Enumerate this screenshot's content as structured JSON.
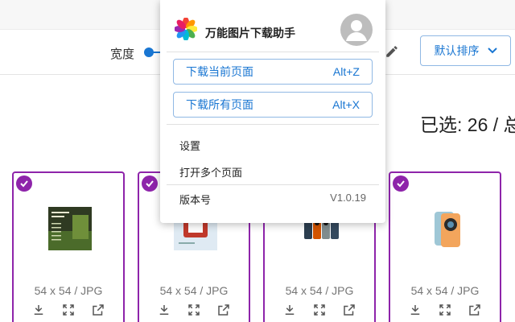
{
  "toolbar": {
    "width_label": "宽度",
    "width_value_fraction": 0.05,
    "sort_label": "默认排序"
  },
  "selection": {
    "text": "已选: 26 / 总"
  },
  "cards": [
    {
      "meta": "54 x 54 / JPG",
      "thumb": "nature-infographic"
    },
    {
      "meta": "54 x 54 / JPG",
      "thumb": "product-chip"
    },
    {
      "meta": "54 x 54 / JPG",
      "thumb": "phone-lineup"
    },
    {
      "meta": "54 x 54 / JPG",
      "thumb": "phone-back"
    }
  ],
  "popup": {
    "app_title": "万能图片下载助手",
    "download_current": {
      "label": "下载当前页面",
      "shortcut": "Alt+Z"
    },
    "download_all": {
      "label": "下载所有页面",
      "shortcut": "Alt+X"
    },
    "settings": "设置",
    "open_multiple": "打开多个页面",
    "version_label": "版本号",
    "version_value": "V1.0.19"
  },
  "colors": {
    "accent": "#1976d2",
    "selected": "#8e24aa"
  },
  "icons": [
    "pinwheel-logo-icon",
    "avatar-icon",
    "pencil-icon",
    "chevron-down-icon",
    "check-icon",
    "download-icon",
    "fullscreen-icon",
    "open-external-icon"
  ]
}
